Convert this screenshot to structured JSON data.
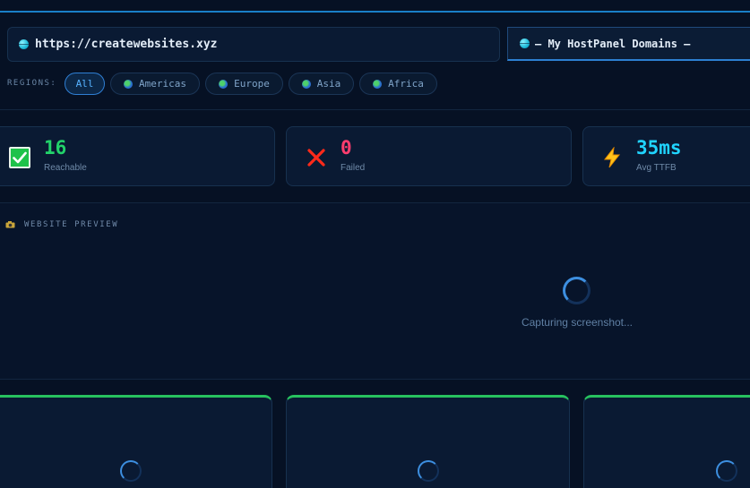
{
  "url_bar": {
    "url": "https://createwebsites.xyz",
    "icon": "globe-icon"
  },
  "domain_select": {
    "selected": "— My HostPanel Domains —",
    "icon": "globe-icon"
  },
  "regions": {
    "label": "REGIONS:",
    "chips": [
      {
        "label": "All",
        "active": true
      },
      {
        "label": "Americas",
        "icon": "earth-icon"
      },
      {
        "label": "Europe",
        "icon": "earth-icon"
      },
      {
        "label": "Asia",
        "icon": "earth-icon"
      },
      {
        "label": "Africa",
        "icon": "earth-icon"
      }
    ]
  },
  "stats": {
    "reachable": {
      "value": "16",
      "label": "Reachable",
      "icon": "check-icon",
      "color": "#22d36a"
    },
    "failed": {
      "value": "0",
      "label": "Failed",
      "icon": "cross-icon",
      "color": "#ff3d6e"
    },
    "ttfb": {
      "value": "35ms",
      "label": "Avg TTFB",
      "icon": "lightning-icon",
      "color": "#20d4ff"
    }
  },
  "preview": {
    "title": "WEBSITE PREVIEW",
    "icon": "camera-icon",
    "status": "Capturing screenshot..."
  },
  "colors": {
    "background": "#061124",
    "accent": "#2c7fd1",
    "success": "#27c25f"
  }
}
